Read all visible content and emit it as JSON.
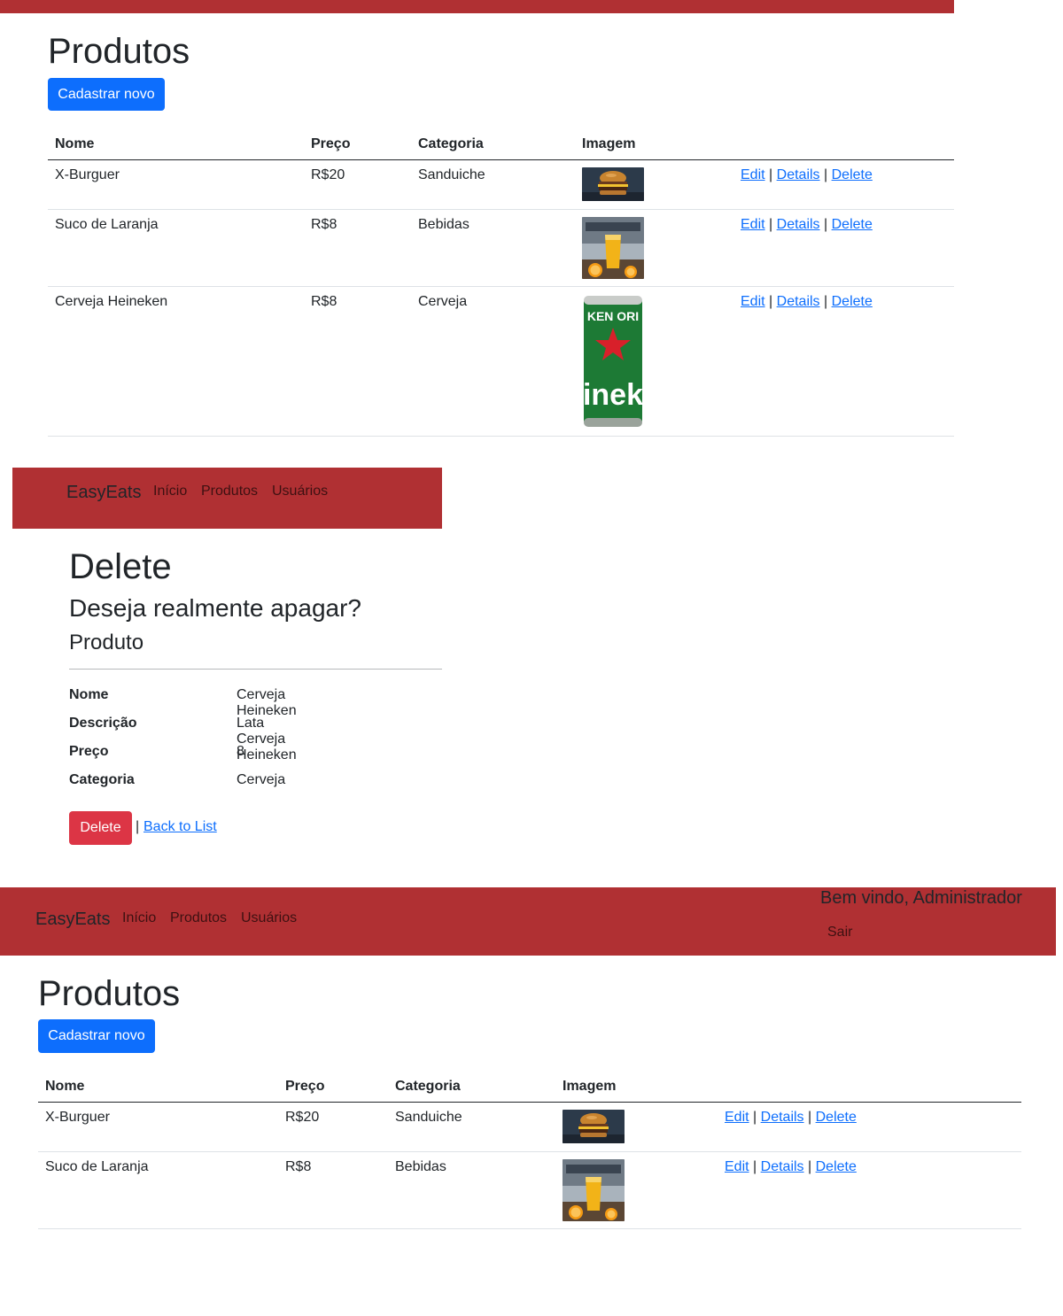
{
  "colors": {
    "navbar": "#b03033",
    "primary": "#0d6efd",
    "danger": "#dc3545",
    "link": "#0d6efd"
  },
  "screen1": {
    "title": "Produtos",
    "new_button": "Cadastrar novo",
    "columns": [
      "Nome",
      "Preço",
      "Categoria",
      "Imagem"
    ],
    "rows": [
      {
        "name": "X-Burguer",
        "price": "R$20",
        "category": "Sanduiche",
        "image": "burger-image"
      },
      {
        "name": "Suco de Laranja",
        "price": "R$8",
        "category": "Bebidas",
        "image": "orange-juice-image"
      },
      {
        "name": "Cerveja Heineken",
        "price": "R$8",
        "category": "Cerveja",
        "image": "heineken-can-image"
      }
    ]
  },
  "links": {
    "edit": "Edit",
    "details": "Details",
    "delete": "Delete",
    "sep": "|"
  },
  "screen2": {
    "brand": "EasyEats",
    "nav": [
      "Início",
      "Produtos",
      "Usuários"
    ],
    "title": "Delete",
    "question": "Deseja realmente apagar?",
    "subtitle": "Produto",
    "fields": [
      {
        "label": "Nome",
        "value": "Cerveja Heineken"
      },
      {
        "label": "Descrição",
        "value": "Lata Cerveja Heineken"
      },
      {
        "label": "Preço",
        "value": "8"
      },
      {
        "label": "Categoria",
        "value": "Cerveja"
      }
    ],
    "delete_button": "Delete",
    "sep": "|",
    "back_link": "Back to List"
  },
  "screen3": {
    "brand": "EasyEats",
    "nav": [
      "Início",
      "Produtos",
      "Usuários"
    ],
    "welcome": "Bem vindo, Administrador",
    "logout": "Sair",
    "title": "Produtos",
    "new_button": "Cadastrar novo",
    "columns": [
      "Nome",
      "Preço",
      "Categoria",
      "Imagem"
    ],
    "rows": [
      {
        "name": "X-Burguer",
        "price": "R$20",
        "category": "Sanduiche",
        "image": "burger-image"
      },
      {
        "name": "Suco de Laranja",
        "price": "R$8",
        "category": "Bebidas",
        "image": "orange-juice-image"
      }
    ]
  }
}
